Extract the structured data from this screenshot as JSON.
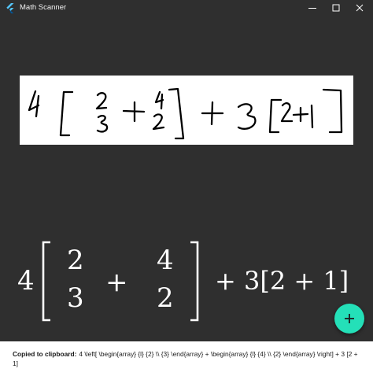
{
  "window": {
    "title": "Math Scanner",
    "icon": "flutter-logo-icon"
  },
  "colors": {
    "background": "#2f2f2f",
    "accent": "#24e0b8",
    "snackbar_background": "#ffffff"
  },
  "scan": {
    "content": "handwritten expression: 4 [ 2/3 + 4/2 ] + 3 [2+1]"
  },
  "rendered": {
    "coefficient": "4",
    "matrix1_top": "2",
    "matrix1_bottom": "3",
    "plus1": "+",
    "matrix2_top": "4",
    "matrix2_bottom": "2",
    "tail": "+ 3[2 + 1]"
  },
  "fab": {
    "icon": "plus-icon"
  },
  "snackbar": {
    "label": "Copied to clipboard:",
    "text": "4 \\left[ \\begin{array} {l} {2} \\\\ {3} \\end{array} + \\begin{array} {l} {4} \\\\ {2} \\end{array} \\right] + 3 [2 + 1]"
  }
}
